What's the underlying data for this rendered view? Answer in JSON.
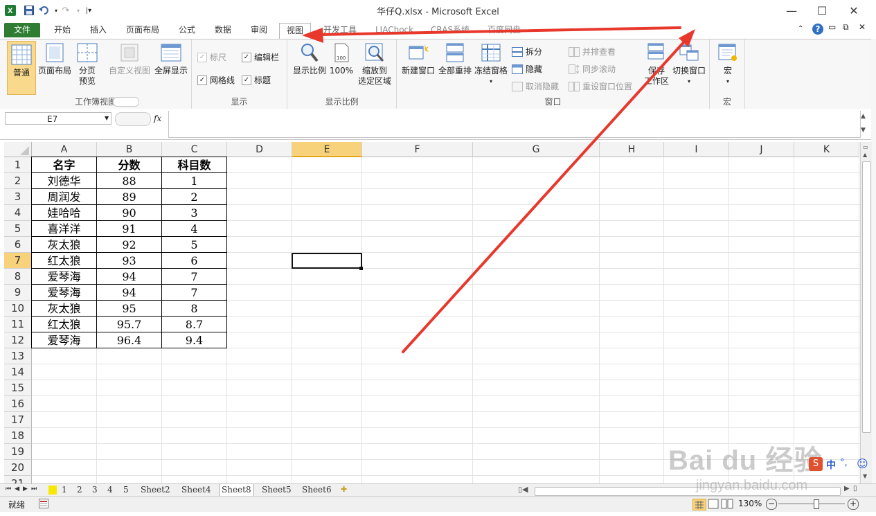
{
  "window": {
    "title": "华仔Q.xlsx - Microsoft Excel",
    "minimize": "—",
    "maximize": "☐",
    "close": "✕"
  },
  "tabs": [
    "文件",
    "开始",
    "插入",
    "页面布局",
    "公式",
    "数据",
    "审阅",
    "视图",
    "开发工具",
    "LIAChock",
    "CRAS系统",
    "百度网盘"
  ],
  "active_tab": "视图",
  "ribbon": {
    "workbook_views": {
      "label": "工作簿视图",
      "normal": "普通",
      "page_layout": "页面布局",
      "page_break_1": "分页",
      "page_break_2": "预览",
      "custom_views": "自定义视图",
      "full_screen": "全屏显示"
    },
    "show": {
      "label": "显示",
      "ruler": "标尺",
      "formula_bar": "编辑栏",
      "gridlines": "网格线",
      "headings": "标题"
    },
    "zoom": {
      "label": "显示比例",
      "zoom": "显示比例",
      "hundred": "100%",
      "zoom_sel_1": "缩放到",
      "zoom_sel_2": "选定区域"
    },
    "window": {
      "label": "窗口",
      "new_window": "新建窗口",
      "arrange_all": "全部重排",
      "freeze_panes": "冻结窗格",
      "split": "拆分",
      "hide": "隐藏",
      "unhide": "取消隐藏",
      "side_by_side": "并排查看",
      "sync_scroll": "同步滚动",
      "reset_pos": "重设窗口位置",
      "save_ws_1": "保存",
      "save_ws_2": "工作区",
      "switch_windows": "切换窗口"
    },
    "macros": {
      "label": "宏",
      "macros": "宏"
    }
  },
  "formula_bar": {
    "name_box": "E7",
    "fx": "fx",
    "content": ""
  },
  "columns": [
    "A",
    "B",
    "C",
    "D",
    "E",
    "F",
    "G",
    "H",
    "I",
    "J",
    "K"
  ],
  "selected_column": "E",
  "selected_row": "7",
  "rows": [
    "1",
    "2",
    "3",
    "4",
    "5",
    "6",
    "7",
    "8",
    "9",
    "10",
    "11",
    "12",
    "13",
    "14",
    "15",
    "16",
    "17",
    "18",
    "19",
    "20",
    "21"
  ],
  "table": {
    "header": [
      "名字",
      "分数",
      "科目数"
    ],
    "data": [
      [
        "刘德华",
        "88",
        "1"
      ],
      [
        "周润发",
        "89",
        "2"
      ],
      [
        "娃哈哈",
        "90",
        "3"
      ],
      [
        "喜洋洋",
        "91",
        "4"
      ],
      [
        "灰太狼",
        "92",
        "5"
      ],
      [
        "红太狼",
        "93",
        "6"
      ],
      [
        "爱琴海",
        "94",
        "7"
      ],
      [
        "爱琴海",
        "94",
        "7"
      ],
      [
        "灰太狼",
        "95",
        "8"
      ],
      [
        "红太狼",
        "95.7",
        "8.7"
      ],
      [
        "爱琴海",
        "96.4",
        "9.4"
      ]
    ]
  },
  "sheets": [
    "1",
    "2",
    "3",
    "4",
    "5",
    "Sheet2",
    "Sheet4",
    "Sheet8",
    "Sheet5",
    "Sheet6"
  ],
  "active_sheet": "Sheet8",
  "status": {
    "ready": "就绪",
    "zoom": "130%"
  },
  "ime": {
    "lang": "中",
    "punct": "°,"
  },
  "watermark": {
    "brand": "Bai du 经验",
    "url": "jingyan.baidu.com"
  },
  "colors": {
    "file_tab": "#2e7d32",
    "selection_header": "#f7d27a",
    "annotation_arrow": "#e8372b"
  }
}
